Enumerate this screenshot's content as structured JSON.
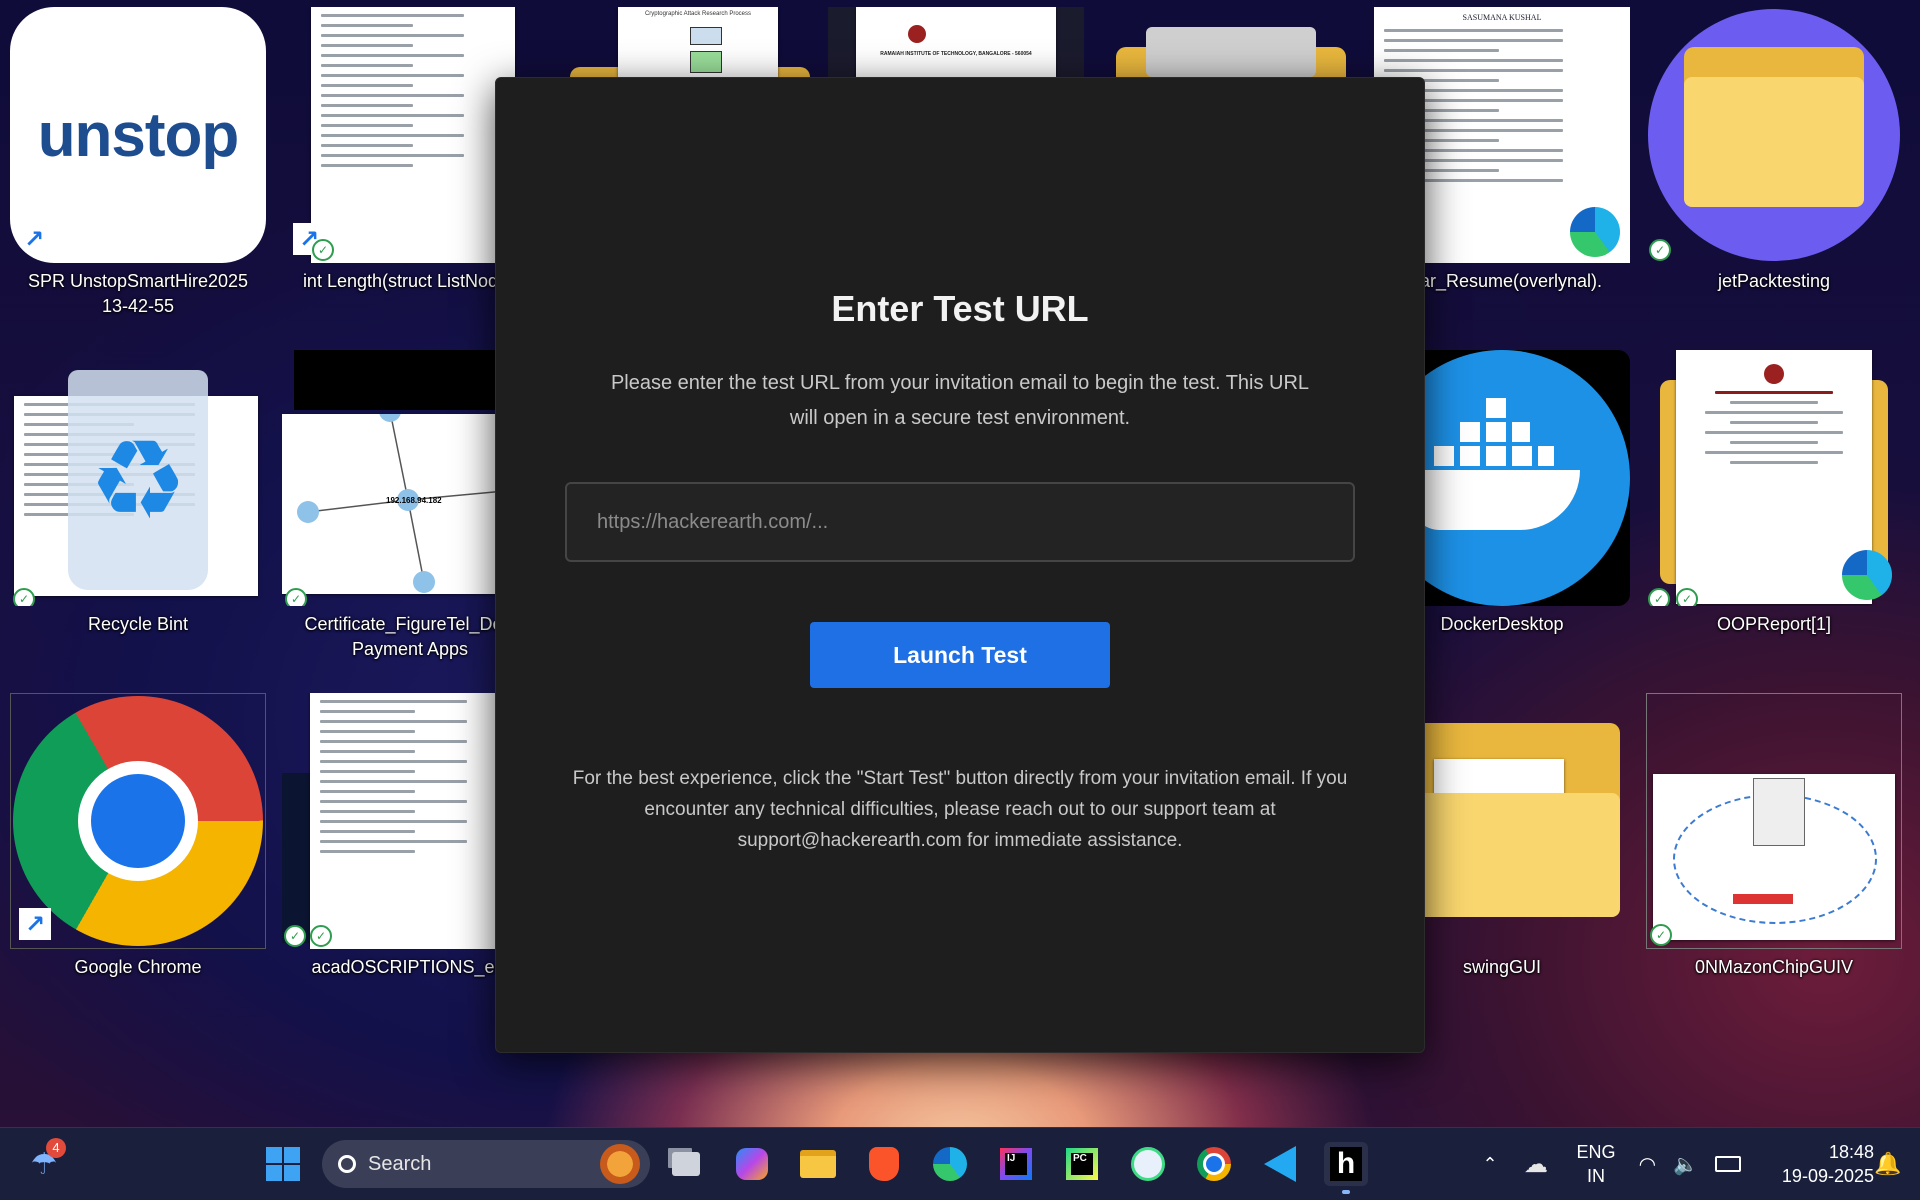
{
  "desktop": {
    "icons": [
      {
        "label": "SPR UnstopSmartHire2025\n13-42-55",
        "kind": "unstop"
      },
      {
        "label": "int Length(struct ListNode h",
        "kind": "code"
      },
      {
        "label": "",
        "kind": "diagram"
      },
      {
        "label": "",
        "kind": "report-top"
      },
      {
        "label": "",
        "kind": "folder-top"
      },
      {
        "label": "ellar_Resume(overlynal).",
        "kind": "resume"
      },
      {
        "label": "jetPacktesting",
        "kind": "folder-circle"
      },
      {
        "label": "Recycle Bint",
        "kind": "recycle"
      },
      {
        "label": "Certificate_FigureTel_Desi\nPayment Apps",
        "kind": "graph"
      },
      {
        "label": "DockerDesktop",
        "kind": "docker"
      },
      {
        "label": "OOPReport[1]",
        "kind": "report"
      },
      {
        "label": "Google Chrome",
        "kind": "chrome"
      },
      {
        "label": "acadOSCRIPTIONS_edi",
        "kind": "code2"
      },
      {
        "label": "swingGUI",
        "kind": "folder-java"
      },
      {
        "label": "0NMazonChipGUIV",
        "kind": "network"
      }
    ],
    "unstop_logo_text": "unstop",
    "report_title": "RAMAIAH INSTITUTE OF TECHNOLOGY, BANGALORE - 560054",
    "resume_name": "SASUMANA KUSHAL",
    "diagram_title": "Cryptographic Attack Research Process",
    "graph_center_label": "192.168.94.182"
  },
  "modal": {
    "title": "Enter Test URL",
    "description": "Please enter the test URL from your invitation email to begin the test. This URL will open in a secure test environment.",
    "input_placeholder": "https://hackerearth.com/...",
    "input_value": "",
    "launch_button": "Launch Test",
    "footer": "For the best experience, click the \"Start Test\" button directly from your invitation email. If you encounter any technical difficulties, please reach out to our support team at support@hackerearth.com for immediate assistance."
  },
  "taskbar": {
    "weather_badge": "4",
    "search_label": "Search",
    "apps": [
      "start-icon",
      "search",
      "task-view-icon",
      "copilot-icon",
      "file-explorer-icon",
      "brave-icon",
      "edge-icon",
      "intellij-icon",
      "pycharm-icon",
      "android-studio-icon",
      "chrome-icon",
      "vscode-icon",
      "hackerearth-icon"
    ],
    "language_line1": "ENG",
    "language_line2": "IN",
    "time": "18:48",
    "date": "19-09-2025"
  },
  "colors": {
    "accent_button": "#1f6fe5",
    "modal_bg": "#1e1e1e",
    "taskbar_bg": "#1a1f3b"
  }
}
